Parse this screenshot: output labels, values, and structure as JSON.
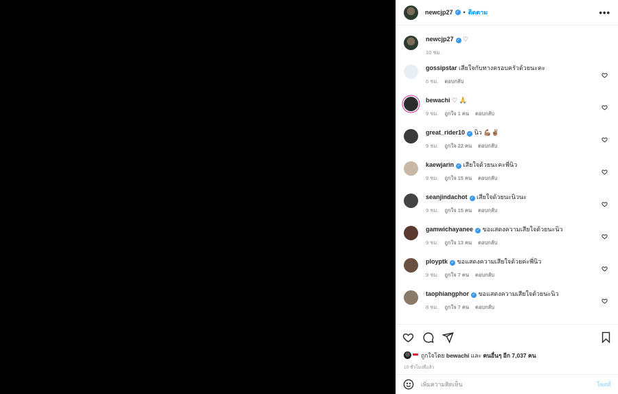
{
  "header": {
    "username": "newcjp27",
    "verified": "✓",
    "dot": "•",
    "follow_label": "ติดตาม",
    "more": "•••"
  },
  "caption": {
    "username": "newcjp27",
    "text": "♡",
    "time": "10 ชม."
  },
  "comments": [
    {
      "username": "gossipstar",
      "verified": false,
      "text": "เสียใจกับทางครอบครัวด้วยนะคะ",
      "time": "6 ชม.",
      "likes": "",
      "reply": "ตอบกลับ",
      "avatar_color": "#e9eef6"
    },
    {
      "username": "bewachi",
      "verified": false,
      "text": "♡ 🙏",
      "time": "9 ชม.",
      "likes": "ถูกใจ 1 คน",
      "reply": "ตอบกลับ",
      "avatar_color": "#2b2b2b"
    },
    {
      "username": "great_rider10",
      "verified": true,
      "text": "นิว 💪🏽✌🏽",
      "time": "9 ชม.",
      "likes": "ถูกใจ 22 คน",
      "reply": "ตอบกลับ",
      "avatar_color": "#3a3a3a"
    },
    {
      "username": "kaewjarin",
      "verified": true,
      "text": "เสียใจด้วยนะคะพี่นิว",
      "time": "9 ชม.",
      "likes": "ถูกใจ 15 คน",
      "reply": "ตอบกลับ",
      "avatar_color": "#c9b8a8"
    },
    {
      "username": "seanjindachot",
      "verified": true,
      "text": "เสียใจด้วยนะนิวนะ",
      "time": "9 ชม.",
      "likes": "ถูกใจ 15 คน",
      "reply": "ตอบกลับ",
      "avatar_color": "#444"
    },
    {
      "username": "gamwichayanee",
      "verified": true,
      "text": "ขอแสดงความเสียใจด้วยนะนิว",
      "time": "9 ชม.",
      "likes": "ถูกใจ 13 คน",
      "reply": "ตอบกลับ",
      "avatar_color": "#5a3a30"
    },
    {
      "username": "ployptk",
      "verified": true,
      "text": "ขอแสดงความเสียใจด้วยค่ะพี่นิว",
      "time": "9 ชม.",
      "likes": "ถูกใจ 7 คน",
      "reply": "ตอบกลับ",
      "avatar_color": "#6a5040"
    },
    {
      "username": "taophiangphor",
      "verified": true,
      "text": "ขอแสดงความเสียใจด้วยนะนิว",
      "time": "8 ชม.",
      "likes": "ถูกใจ 7 คน",
      "reply": "ตอบกลับ",
      "avatar_color": "#8a7a68"
    }
  ],
  "likes_line": {
    "prefix": "ถูกใจโดย",
    "user": "bewachi",
    "and": "และ",
    "others": "คนอื่นๆ อีก 7,037 คน"
  },
  "post_time": "10 ชั่วโมงที่แล้ว",
  "add_comment": {
    "placeholder": "เพิ่มความคิดเห็น",
    "post_label": "โพสต์"
  },
  "colors": {
    "accent": "#0095f6",
    "verified": "#3897f0",
    "media_bg": "#000000"
  }
}
